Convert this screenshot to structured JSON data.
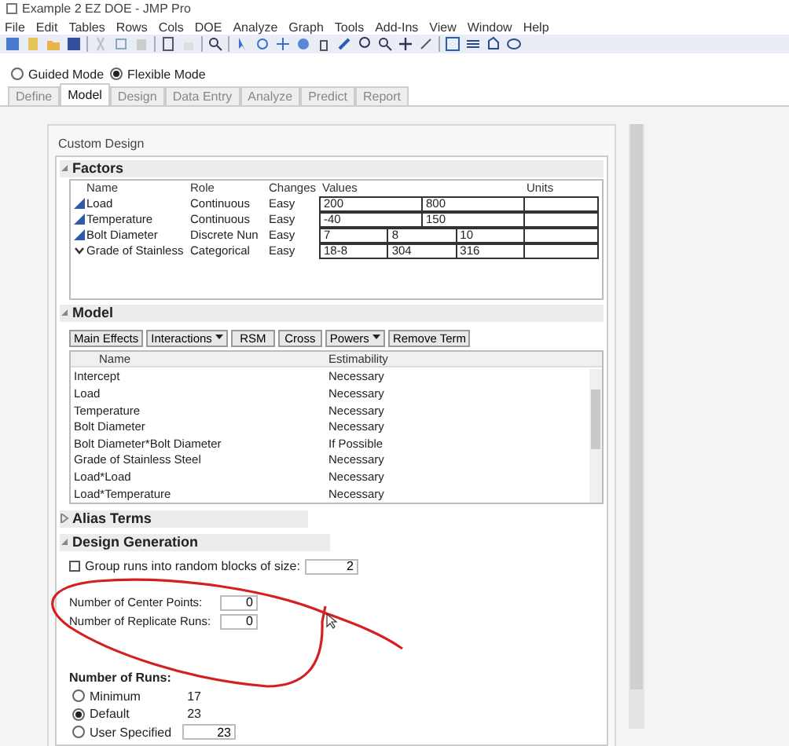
{
  "window": {
    "title": "Example 2 EZ DOE - JMP Pro"
  },
  "menu": [
    "File",
    "Edit",
    "Tables",
    "Rows",
    "Cols",
    "DOE",
    "Analyze",
    "Graph",
    "Tools",
    "Add-Ins",
    "View",
    "Window",
    "Help"
  ],
  "modes": [
    {
      "label": "Guided Mode",
      "selected": false
    },
    {
      "label": "Flexible Mode",
      "selected": true
    }
  ],
  "tabs": [
    {
      "label": "Define",
      "selected": false
    },
    {
      "label": "Model",
      "selected": true
    },
    {
      "label": "Design",
      "selected": false
    },
    {
      "label": "Data Entry",
      "selected": false
    },
    {
      "label": "Analyze",
      "selected": false
    },
    {
      "label": "Predict",
      "selected": false
    },
    {
      "label": "Report",
      "selected": false
    }
  ],
  "panel_title": "Custom Design",
  "factors": {
    "title": "Factors",
    "expanded": true,
    "columns": [
      "Name",
      "Role",
      "Changes",
      "Values",
      "Units"
    ],
    "rows": [
      {
        "kind": "numeric",
        "name": "Load",
        "role": "Continuous",
        "changes": "Easy",
        "values": [
          "200",
          "800"
        ]
      },
      {
        "kind": "numeric",
        "name": "Temperature",
        "role": "Continuous",
        "changes": "Easy",
        "values": [
          "-40",
          "150"
        ]
      },
      {
        "kind": "numeric",
        "name": "Bolt Diameter",
        "role": "Discrete Nun",
        "changes": "Easy",
        "values": [
          "7",
          "8",
          "10"
        ]
      },
      {
        "kind": "categorical",
        "name": "Grade of Stainless",
        "role": "Categorical",
        "changes": "Easy",
        "values": [
          "18-8",
          "304",
          "316"
        ]
      }
    ]
  },
  "model": {
    "title": "Model",
    "expanded": true,
    "buttons": [
      {
        "label": "Main Effects",
        "dropdown": false
      },
      {
        "label": "Interactions",
        "dropdown": true
      },
      {
        "label": "RSM",
        "dropdown": false
      },
      {
        "label": "Cross",
        "dropdown": false
      },
      {
        "label": "Powers",
        "dropdown": true
      },
      {
        "label": "Remove Term",
        "dropdown": false
      }
    ],
    "columns": [
      "Name",
      "Estimability"
    ],
    "rows": [
      {
        "name": "Intercept",
        "estimability": "Necessary"
      },
      {
        "name": "Load",
        "estimability": "Necessary"
      },
      {
        "name": "Temperature",
        "estimability": "Necessary"
      },
      {
        "name": "Bolt Diameter",
        "estimability": "Necessary"
      },
      {
        "name": "Bolt Diameter*Bolt Diameter",
        "estimability": "If Possible"
      },
      {
        "name": "Grade of Stainless Steel",
        "estimability": "Necessary"
      },
      {
        "name": "Load*Load",
        "estimability": "Necessary"
      },
      {
        "name": "Load*Temperature",
        "estimability": "Necessary"
      }
    ]
  },
  "alias_terms": {
    "title": "Alias Terms",
    "expanded": false
  },
  "design_generation": {
    "title": "Design Generation",
    "expanded": true,
    "group_runs": {
      "label": "Group runs into random blocks of size:",
      "checked": false,
      "value": "2"
    },
    "fields": [
      {
        "label": "Number of Center Points:",
        "value": "0"
      },
      {
        "label": "Number of Replicate Runs:",
        "value": "0"
      }
    ],
    "runs_title": "Number of Runs:",
    "runs": [
      {
        "kind": "count",
        "label": "Minimum",
        "selected": false,
        "value": "17"
      },
      {
        "kind": "count",
        "label": "Default",
        "selected": true,
        "value": "23"
      },
      {
        "kind": "input",
        "label": "User Specified",
        "selected": false,
        "value": "23"
      }
    ]
  }
}
